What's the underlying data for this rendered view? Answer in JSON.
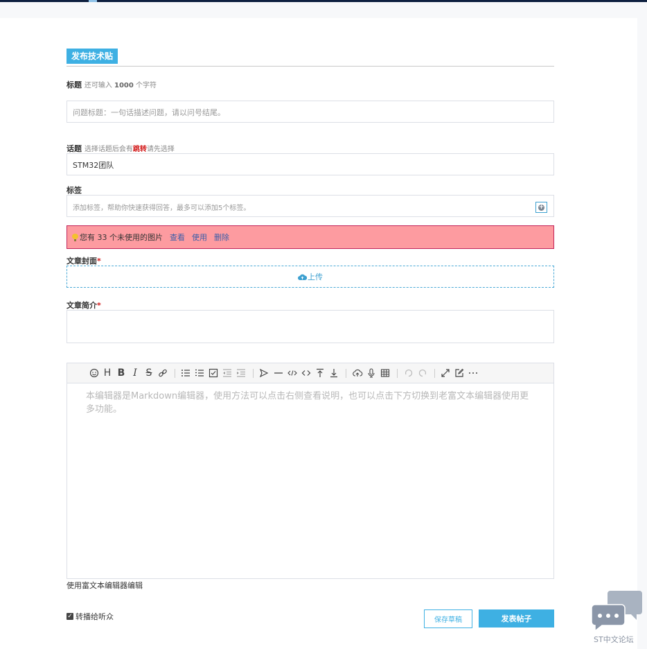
{
  "heading": {
    "title": "发布技术贴"
  },
  "title_field": {
    "label": "标题",
    "hint_prefix": "还可输入",
    "hint_count": "1000",
    "hint_suffix": "个字符",
    "placeholder": "问题标题：一句话描述问题，请以问号结尾。"
  },
  "topic_field": {
    "label": "话题",
    "hint_prefix": "选择话题后会有",
    "hint_red": "跳转",
    "hint_suffix": "请先选择",
    "value": "STM32团队"
  },
  "tag_field": {
    "label": "标签",
    "placeholder": "添加标签，帮助你快速获得回答，最多可以添加5个标签。",
    "add_icon": "plus-circle-icon"
  },
  "alert": {
    "icon": "lightbulb-icon",
    "text": "您有 33 个未使用的图片",
    "view": "查看",
    "use": "使用",
    "delete": "删除",
    "bg_color": "#fd9ba0",
    "border_color": "#c1245a"
  },
  "cover_field": {
    "label": "文章封面",
    "required_mark": "*",
    "upload_icon": "cloud-upload-icon",
    "upload_label": "上传"
  },
  "summary_field": {
    "label": "文章简介",
    "required_mark": "*"
  },
  "editor": {
    "toolbar_icons": [
      "emoji-icon",
      "heading-icon",
      "bold-icon",
      "italic-icon",
      "strikethrough-icon",
      "link-icon",
      "unordered-list-icon",
      "ordered-list-icon",
      "task-list-icon",
      "outdent-icon",
      "indent-icon",
      "quote-icon",
      "horizontal-rule-icon",
      "inline-code-icon",
      "code-block-icon",
      "to-top-icon",
      "to-bottom-icon",
      "upload-icon",
      "audio-icon",
      "table-icon",
      "undo-icon",
      "redo-icon",
      "fullscreen-icon",
      "edit-mode-icon",
      "more-icon"
    ],
    "placeholder": "本编辑器是Markdown编辑器，使用方法可以点击右侧查看说明，也可以点击下方切换到老富文本编辑器使用更多功能。"
  },
  "switch_editor": {
    "label": "使用富文本编辑器编辑"
  },
  "forward": {
    "label": "转播给听众",
    "checked": true
  },
  "buttons": {
    "draft": "保存草稿",
    "post": "发表帖子"
  },
  "forum": {
    "icon": "chat-bubbles-icon",
    "label": "ST中文论坛"
  },
  "colors": {
    "accent": "#3eb0e3",
    "required": "#d21a1a"
  }
}
